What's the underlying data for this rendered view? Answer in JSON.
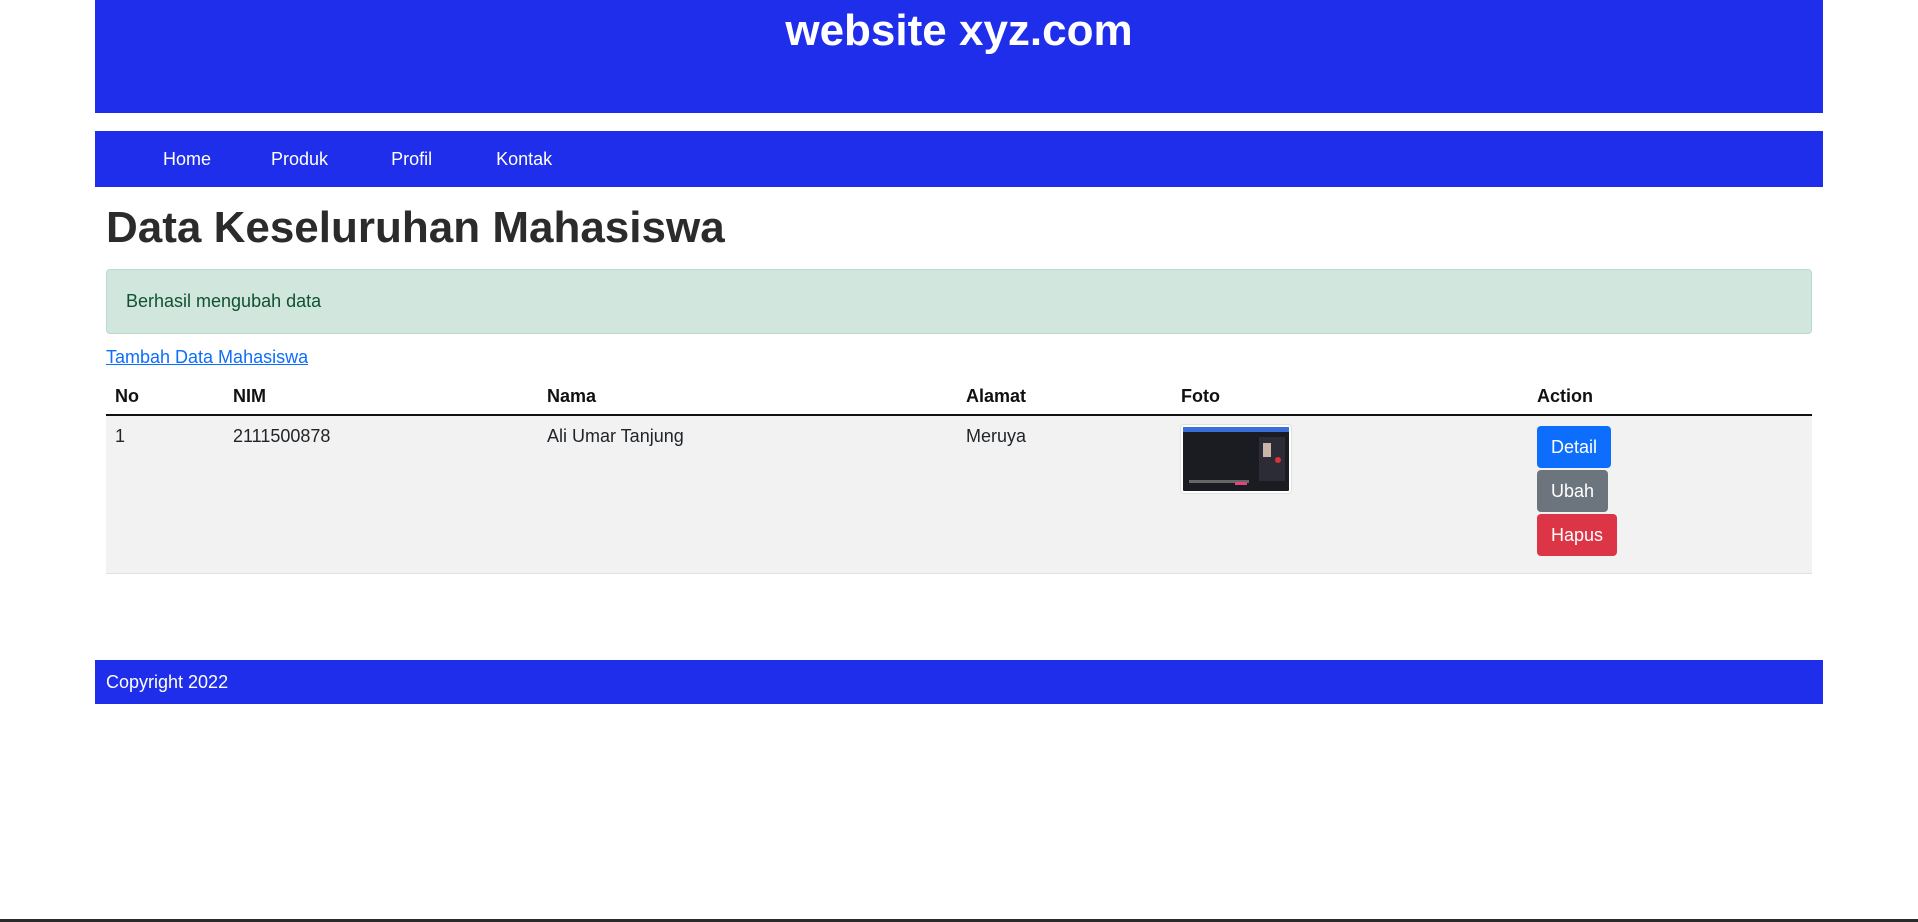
{
  "header": {
    "title": "website xyz.com"
  },
  "nav": {
    "items": [
      {
        "label": "Home"
      },
      {
        "label": "Produk"
      },
      {
        "label": "Profil"
      },
      {
        "label": "Kontak"
      }
    ]
  },
  "main": {
    "heading": "Data Keseluruhan Mahasiswa",
    "alert": "Berhasil mengubah data",
    "add_link": "Tambah Data Mahasiswa",
    "table": {
      "columns": [
        "No",
        "NIM",
        "Nama",
        "Alamat",
        "Foto",
        "Action"
      ],
      "rows": [
        {
          "no": "1",
          "nim": "2111500878",
          "nama": "Ali Umar Tanjung",
          "alamat": "Meruya",
          "foto": "screenshot-thumbnail",
          "actions": {
            "detail": "Detail",
            "ubah": "Ubah",
            "hapus": "Hapus"
          }
        }
      ]
    }
  },
  "footer": {
    "text": "Copyright 2022"
  },
  "colors": {
    "brand": "#1f2eeb",
    "alert_bg": "#d1e7dd",
    "link": "#0d6efd",
    "primary": "#0d6efd",
    "secondary": "#6c757d",
    "danger": "#dc3545"
  }
}
